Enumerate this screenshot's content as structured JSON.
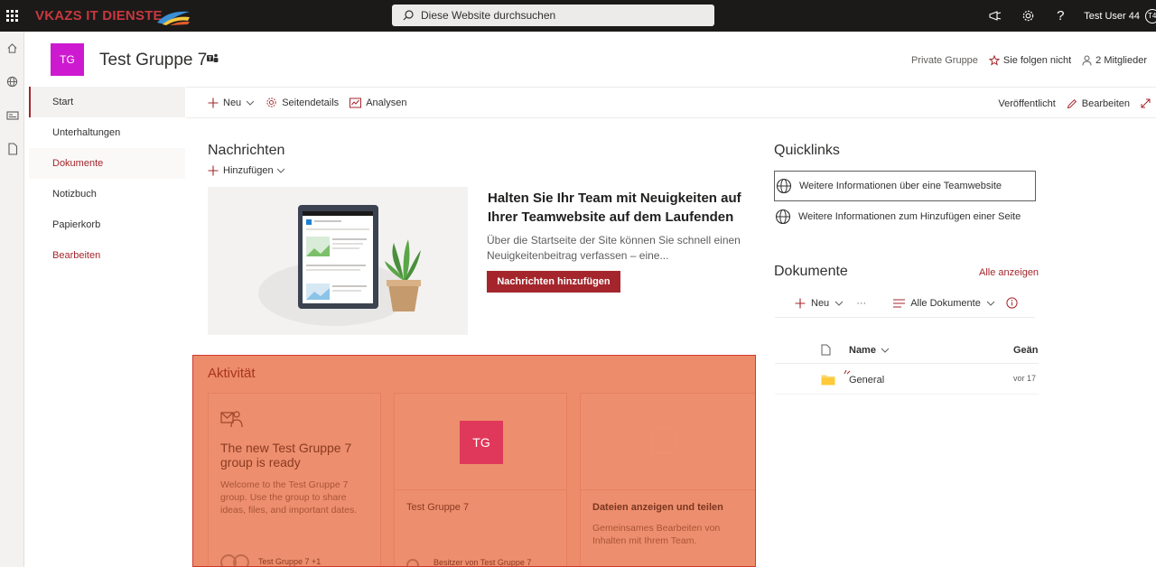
{
  "suite": {
    "brand": "VKAZS IT DIENSTE",
    "search_placeholder": "Diese Website durchsuchen",
    "user_name": "Test User 44",
    "user_initials": "T4"
  },
  "site": {
    "logo_initials": "TG",
    "title": "Test Gruppe 7",
    "privacy": "Private Gruppe",
    "follow": "Sie folgen nicht",
    "members": "2 Mitglieder"
  },
  "nav": {
    "items": [
      {
        "label": "Start"
      },
      {
        "label": "Unterhaltungen"
      },
      {
        "label": "Dokumente"
      },
      {
        "label": "Notizbuch"
      },
      {
        "label": "Papierkorb"
      },
      {
        "label": "Bearbeiten"
      }
    ]
  },
  "cmdbar": {
    "new": "Neu",
    "page_details": "Seitendetails",
    "analytics": "Analysen",
    "published": "Veröffentlicht",
    "edit": "Bearbeiten"
  },
  "news": {
    "title": "Nachrichten",
    "add": "Hinzufügen",
    "heading": "Halten Sie Ihr Team mit Neuigkeiten auf Ihrer Teamwebsite auf dem Laufenden",
    "body": "Über die Startseite der Site können Sie schnell einen Neuigkeitenbeitrag verfassen – eine...",
    "button": "Nachrichten hinzufügen"
  },
  "activity": {
    "title": "Aktivität",
    "card1": {
      "heading": "The new Test Gruppe 7 group is ready",
      "text": "Welcome to the Test Gruppe 7 group. Use the group to share ideas, files, and important dates.",
      "footer": "Test Gruppe 7 +1"
    },
    "card2": {
      "initials": "TG",
      "heading": "Test Gruppe 7",
      "footer": "Besitzer von Test Gruppe 7"
    },
    "card3": {
      "heading": "Dateien anzeigen und teilen",
      "text": "Gemeinsames Bearbeiten von Inhalten mit Ihrem Team."
    }
  },
  "quicklinks": {
    "title": "Quicklinks",
    "items": [
      {
        "label": "Weitere Informationen über eine Teamwebsite"
      },
      {
        "label": "Weitere Informationen zum Hinzufügen einer Seite"
      }
    ]
  },
  "documents": {
    "title": "Dokumente",
    "show_all": "Alle anzeigen",
    "new": "Neu",
    "more": "···",
    "view": "Alle Dokumente",
    "col_name": "Name",
    "col_modified": "Geän",
    "rows": [
      {
        "name": "General",
        "modified": "vor 17"
      }
    ]
  },
  "colors": {
    "accent": "#a4262c",
    "site_logo": "#cd1ad0",
    "highlight": "#ec8c6b"
  }
}
